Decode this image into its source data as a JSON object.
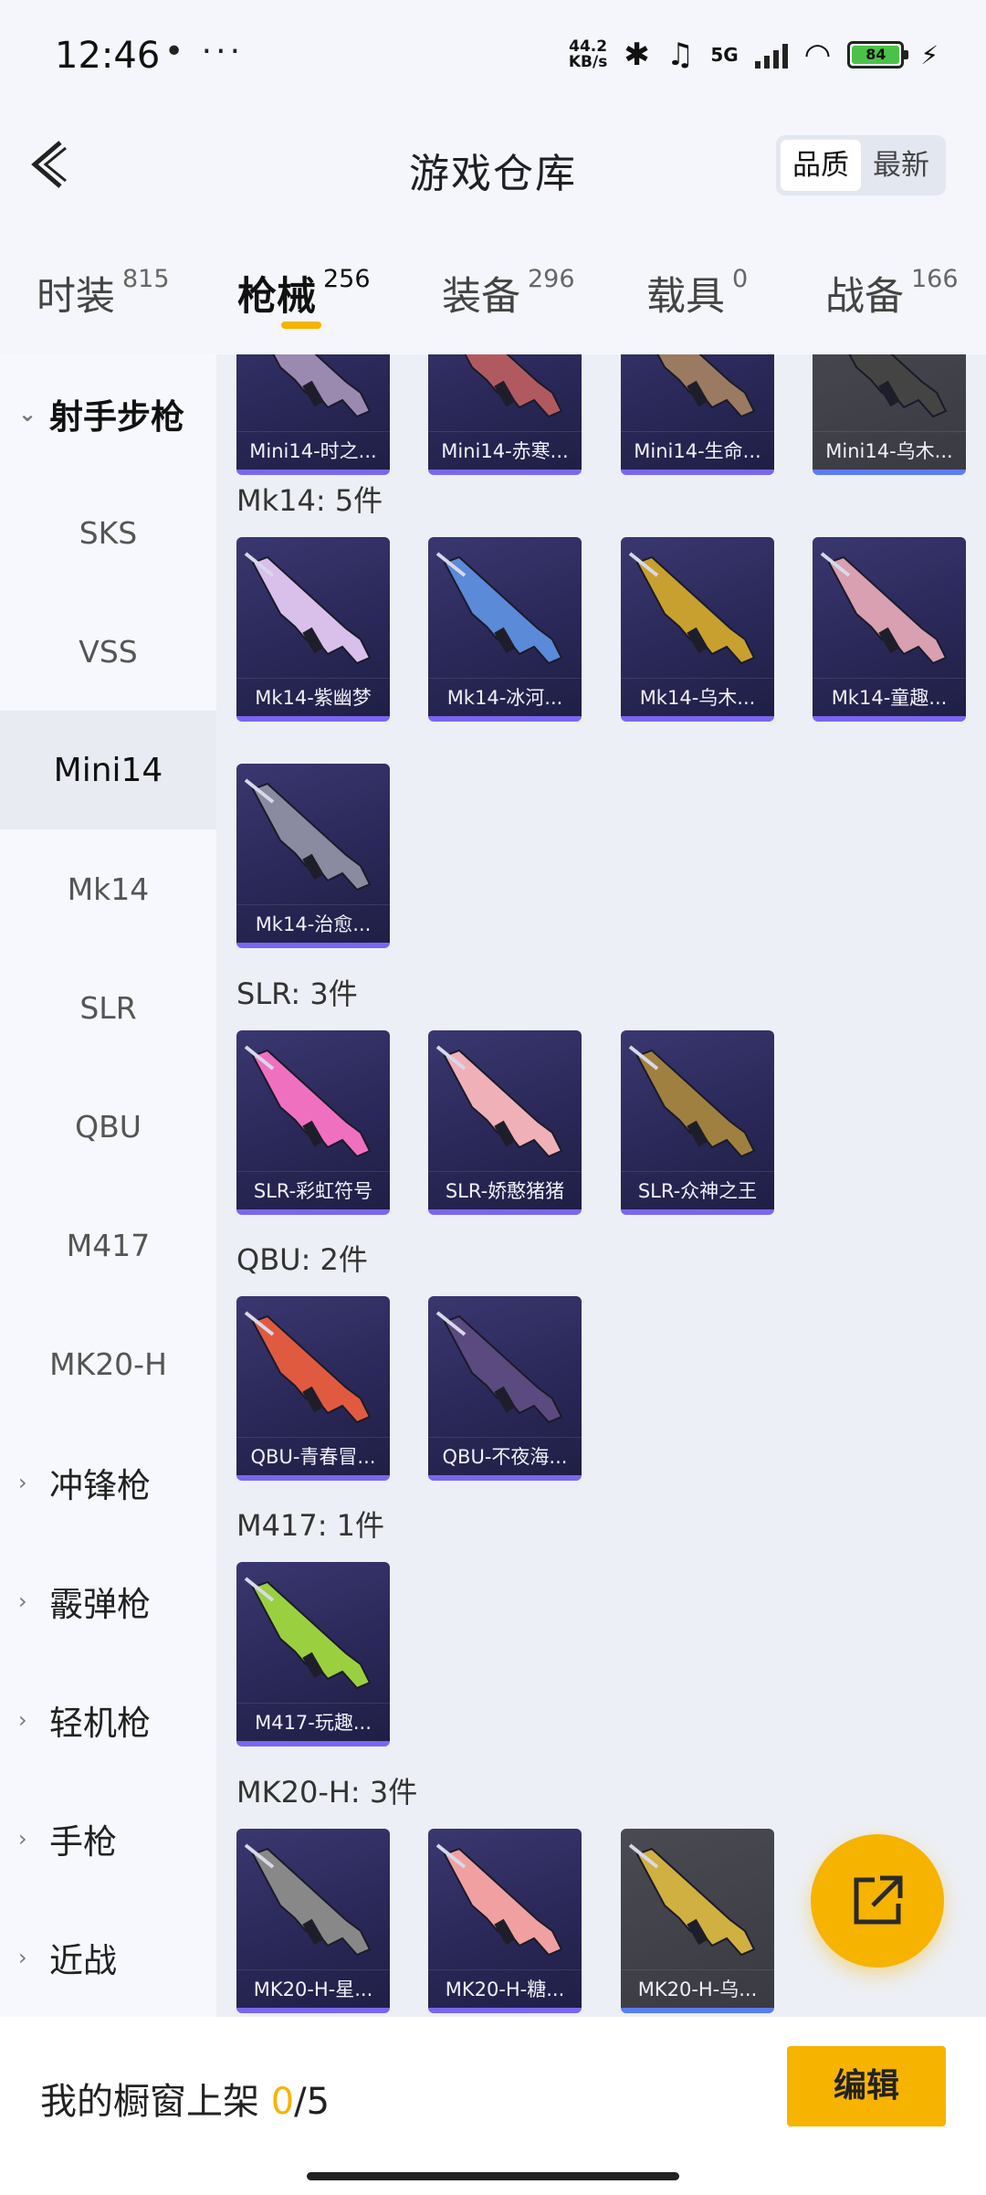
{
  "status_bar": {
    "time": "12:46",
    "dots": "• ···",
    "net_speed_value": "44.2",
    "net_speed_unit": "KB/s",
    "network": "5G",
    "battery": "84"
  },
  "header": {
    "title": "游戏仓库",
    "sort_options": [
      "品质",
      "最新"
    ],
    "sort_active": "品质"
  },
  "tabs": [
    {
      "label": "时装",
      "count": "815"
    },
    {
      "label": "枪械",
      "count": "256"
    },
    {
      "label": "装备",
      "count": "296"
    },
    {
      "label": "载具",
      "count": "0"
    },
    {
      "label": "战备",
      "count": "166"
    }
  ],
  "active_tab": "枪械",
  "sidebar": {
    "parent_open": "射手步枪",
    "sub_items": [
      "SKS",
      "VSS",
      "Mini14",
      "Mk14",
      "SLR",
      "QBU",
      "M417",
      "MK20-H"
    ],
    "active_item": "Mini14",
    "other_parents": [
      "冲锋枪",
      "霰弹枪",
      "轻机枪",
      "手枪",
      "近战"
    ]
  },
  "groups": [
    {
      "title": "",
      "items": [
        "Mini14-时之...",
        "Mini14-赤寒...",
        "Mini14-生命...",
        "Mini14-乌木..."
      ]
    },
    {
      "title": "Mk14: 5件",
      "items": [
        "Mk14-紫幽梦",
        "Mk14-冰河...",
        "Mk14-乌木...",
        "Mk14-童趣...",
        "Mk14-治愈..."
      ]
    },
    {
      "title": "SLR: 3件",
      "items": [
        "SLR-彩虹符号",
        "SLR-娇憨猪猪",
        "SLR-众神之王"
      ]
    },
    {
      "title": "QBU: 2件",
      "items": [
        "QBU-青春冒...",
        "QBU-不夜海..."
      ]
    },
    {
      "title": "M417: 1件",
      "items": [
        "M417-玩趣..."
      ]
    },
    {
      "title": "MK20-H: 3件",
      "items": [
        "MK20-H-星...",
        "MK20-H-糖...",
        "MK20-H-乌..."
      ]
    }
  ],
  "item_colors": {
    "mini14": [
      "#9a8ab0",
      "#b05a60",
      "#9a7a60",
      "#444"
    ],
    "mk14": [
      "#d8c0ea",
      "#5a8ad8",
      "#c8a030",
      "#d8a0b0",
      "#8a8aa0"
    ],
    "slr": [
      "#f070c0",
      "#f0b0b8",
      "#a08040"
    ],
    "qbu": [
      "#e05a40",
      "#5a4a80"
    ],
    "m417": [
      "#9ad040"
    ],
    "mk20h": [
      "#888888",
      "#f0a0a0",
      "#d0b040"
    ]
  },
  "bottom_bar": {
    "shelf_label": "我的橱窗上架",
    "shelf_current": "0",
    "shelf_total": "/5",
    "edit_label": "编辑"
  },
  "fab_icon": "share-icon"
}
